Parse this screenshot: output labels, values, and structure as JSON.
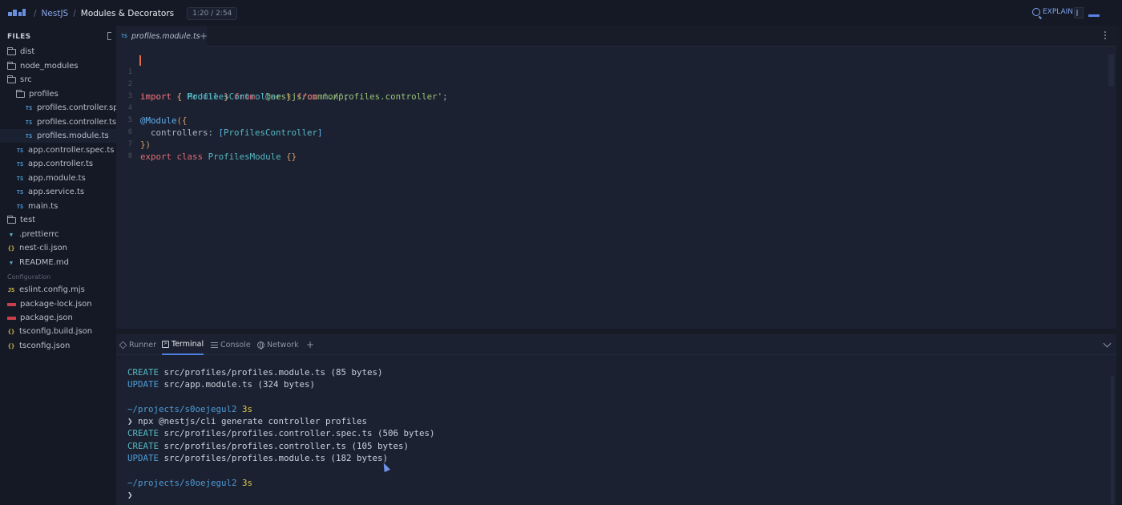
{
  "header": {
    "breadcrumb_course": "NestJS",
    "breadcrumb_lesson": "Modules & Decorators",
    "time": "1:20 / 2:54",
    "explain_label": "EXPLAIN"
  },
  "sidebar": {
    "title": "FILES",
    "items": [
      {
        "type": "folder",
        "label": "dist"
      },
      {
        "type": "folder",
        "label": "node_modules"
      },
      {
        "type": "folder-open",
        "label": "src"
      },
      {
        "type": "folder-open",
        "label": "profiles"
      },
      {
        "type": "ts",
        "label": "profiles.controller.spec.ts"
      },
      {
        "type": "ts",
        "label": "profiles.controller.ts"
      },
      {
        "type": "ts",
        "label": "profiles.module.ts"
      },
      {
        "type": "ts",
        "label": "app.controller.spec.ts"
      },
      {
        "type": "ts",
        "label": "app.controller.ts"
      },
      {
        "type": "ts",
        "label": "app.module.ts"
      },
      {
        "type": "ts",
        "label": "app.service.ts"
      },
      {
        "type": "ts",
        "label": "main.ts"
      },
      {
        "type": "folder",
        "label": "test"
      },
      {
        "type": "prettier",
        "label": ".prettierrc"
      },
      {
        "type": "json",
        "label": "nest-cli.json"
      },
      {
        "type": "md",
        "label": "README.md"
      }
    ],
    "config_title": "Configuration",
    "config_items": [
      {
        "type": "js",
        "label": "eslint.config.mjs"
      },
      {
        "type": "npm",
        "label": "package-lock.json"
      },
      {
        "type": "npm",
        "label": "package.json"
      },
      {
        "type": "json",
        "label": "tsconfig.build.json"
      },
      {
        "type": "json",
        "label": "tsconfig.json"
      }
    ]
  },
  "editor": {
    "tab_label": "profiles.module.ts",
    "tab_badge": "TS",
    "line_numbers": [
      "1",
      "2",
      "3",
      "4",
      "5",
      "6",
      "7",
      "8"
    ]
  },
  "panel": {
    "tabs": [
      "Runner",
      "Terminal",
      "Console",
      "Network"
    ],
    "active_tab": "Terminal",
    "terminal_lines": [
      "CREATE src/profiles/profiles.module.ts (85 bytes)",
      "UPDATE src/app.module.ts (324 bytes)",
      "",
      "~/projects/s0oejegul2 3s",
      "❯ npx @nestjs/cli generate controller profiles",
      "CREATE src/profiles/profiles.controller.spec.ts (506 bytes)",
      "CREATE src/profiles/profiles.controller.ts (105 bytes)",
      "UPDATE src/profiles/profiles.module.ts (182 bytes)",
      "",
      "~/projects/s0oejegul2 3s",
      "❯"
    ]
  },
  "colors": {
    "accent": "#4f7fe0",
    "background": "#161b26"
  }
}
